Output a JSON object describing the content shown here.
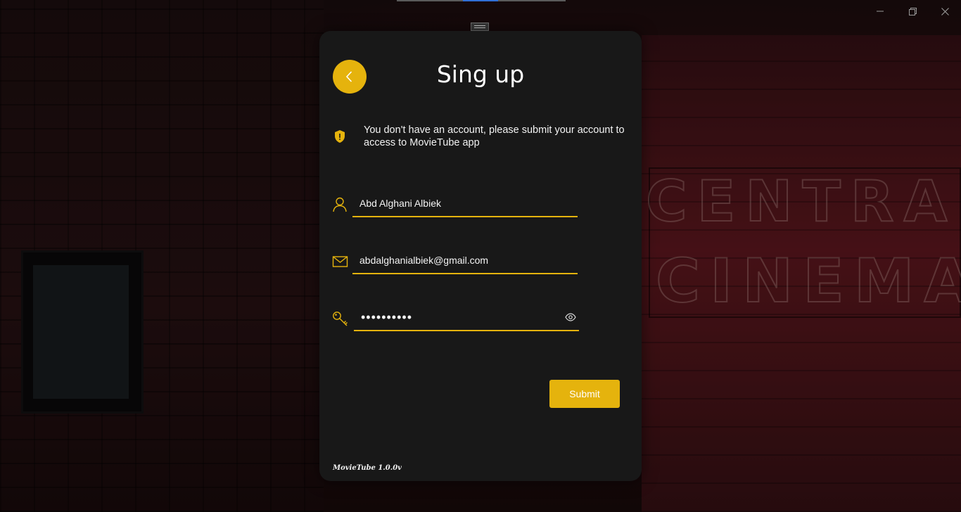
{
  "app": {
    "name": "MovieTube"
  },
  "window": {
    "controls": [
      "minimize-icon",
      "restore-icon",
      "close-icon"
    ]
  },
  "colors": {
    "accent": "#e5b30d",
    "card": "#181818",
    "text": "#ffffff"
  },
  "signup": {
    "title": "Sing up",
    "back_icon": "chevron-left-icon",
    "info": {
      "icon": "shield-icon",
      "text": "You don't have an account, please submit your account to access to MovieTube app"
    },
    "fields": {
      "name": {
        "icon": "user-icon",
        "value": "Abd Alghani Albiek",
        "placeholder": ""
      },
      "email": {
        "icon": "mail-icon",
        "value": "abdalghanialbiek@gmail.com",
        "placeholder": ""
      },
      "password": {
        "icon": "key-icon",
        "value": "••••••••••",
        "reveal_icon": "eye-icon"
      }
    },
    "submit_label": "Submit",
    "version": "MovieTube 1.0.0v"
  }
}
